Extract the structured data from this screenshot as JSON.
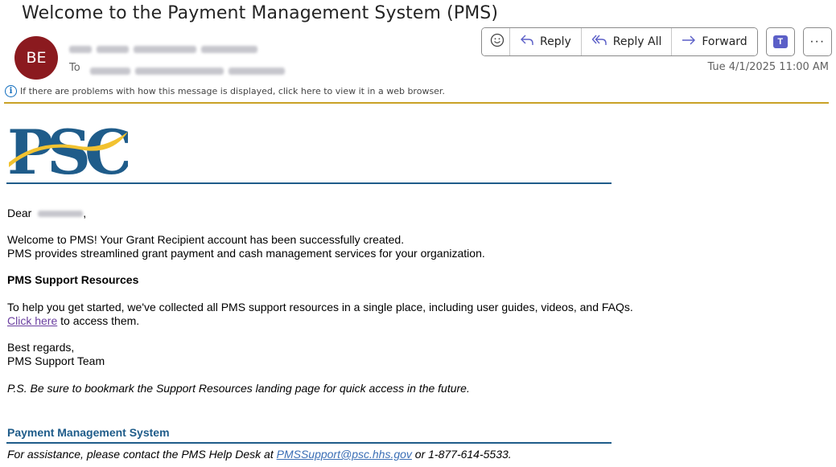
{
  "email": {
    "subject": "Welcome to the Payment Management System (PMS)",
    "sender_initials": "BE",
    "to_label": "To",
    "timestamp": "Tue 4/1/2025 11:00 AM",
    "info_bar": "If there are problems with how this message is displayed, click here to view it in a web browser."
  },
  "toolbar": {
    "reply": "Reply",
    "reply_all": "Reply All",
    "forward": "Forward",
    "more": "···"
  },
  "body": {
    "greeting_prefix": "Dear",
    "greeting_suffix": ",",
    "welcome_line1": "Welcome to PMS! Your Grant Recipient account has been successfully created.",
    "welcome_line2": "PMS provides streamlined grant payment and cash management services for your organization.",
    "resources_heading": "PMS Support Resources",
    "resources_text": "To help you get started, we've collected all PMS support resources in a single place, including user guides, videos, and FAQs.",
    "click_here": "Click here",
    "click_here_suffix": " to access them.",
    "regards": "Best regards,",
    "team": "PMS Support Team",
    "ps": "P.S. Be sure to bookmark the Support Resources landing page for quick access in the future.",
    "footer_title": "Payment Management System",
    "footer_prefix": "For assistance, please contact the PMS Help Desk at ",
    "footer_email": "PMSSupport@psc.hhs.gov",
    "footer_suffix": " or 1-877-614-5533."
  },
  "logo": {
    "text": "PSC"
  },
  "colors": {
    "avatar": "#8b1a1f",
    "accent": "#5b5fc7",
    "gold_rule": "#c9a227",
    "link_visited": "#6b3fa0",
    "footer_blue": "#1f5c8a"
  }
}
